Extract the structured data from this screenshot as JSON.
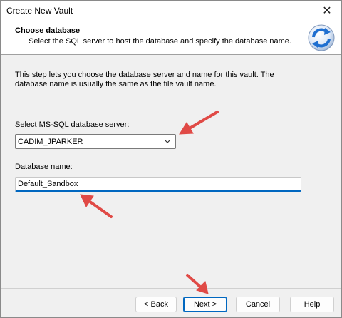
{
  "window": {
    "title": "Create New Vault",
    "close_glyph": "✕"
  },
  "header": {
    "title": "Choose database",
    "subtitle": "Select the SQL server to host the database and specify the database name.",
    "icon": "refresh-arrows-icon"
  },
  "main": {
    "intro": "This step lets you choose the database server and name for this vault. The database name is usually the same as the file vault name.",
    "server_label": "Select MS-SQL database server:",
    "server_value": "CADIM_JPARKER",
    "db_label": "Database name:",
    "db_value": "Default_Sandbox"
  },
  "buttons": {
    "back": "< Back",
    "next": "Next >",
    "cancel": "Cancel",
    "help": "Help"
  },
  "colors": {
    "accent": "#0067c0",
    "annotation_arrow": "#e04a46"
  }
}
